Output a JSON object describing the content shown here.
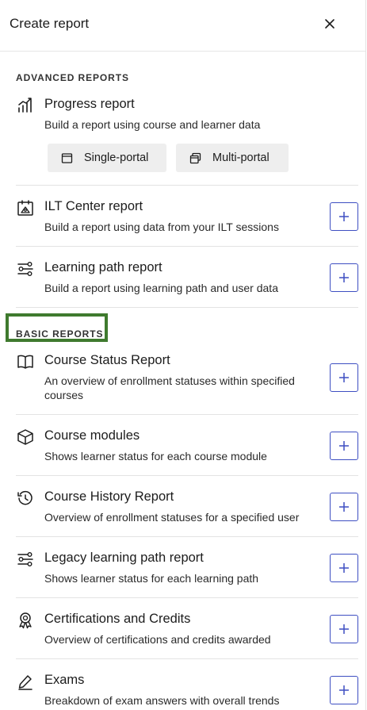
{
  "header": {
    "title": "Create report",
    "close_icon": "close-icon"
  },
  "sections": {
    "advanced": "ADVANCED REPORTS",
    "basic": "BASIC REPORTS"
  },
  "progress": {
    "title": "Progress report",
    "desc": "Build a report using course and learner data",
    "icon": "chart-icon",
    "single_portal": "Single-portal",
    "multi_portal": "Multi-portal"
  },
  "advanced_items": [
    {
      "title": "ILT Center report",
      "desc": "Build a report using data from your ILT sessions",
      "icon": "ilt-center-icon"
    },
    {
      "title": "Learning path report",
      "desc": "Build a report using learning path and user data",
      "icon": "learning-path-icon"
    }
  ],
  "basic_items": [
    {
      "title": "Course Status Report",
      "desc": "An overview of enrollment statuses within specified courses",
      "icon": "book-icon"
    },
    {
      "title": "Course modules",
      "desc": "Shows learner status for each course module",
      "icon": "cube-icon"
    },
    {
      "title": "Course History Report",
      "desc": "Overview of enrollment statuses for a specified user",
      "icon": "history-icon"
    },
    {
      "title": "Legacy learning path report",
      "desc": "Shows learner status for each learning path",
      "icon": "learning-path-icon"
    },
    {
      "title": "Certifications and Credits",
      "desc": "Overview of certifications and credits awarded",
      "icon": "award-icon"
    },
    {
      "title": "Exams",
      "desc": "Breakdown of exam answers with overall trends",
      "icon": "pencil-icon"
    }
  ],
  "colors": {
    "accent": "#3e4fc2",
    "highlight_border": "#3f7a2e"
  }
}
